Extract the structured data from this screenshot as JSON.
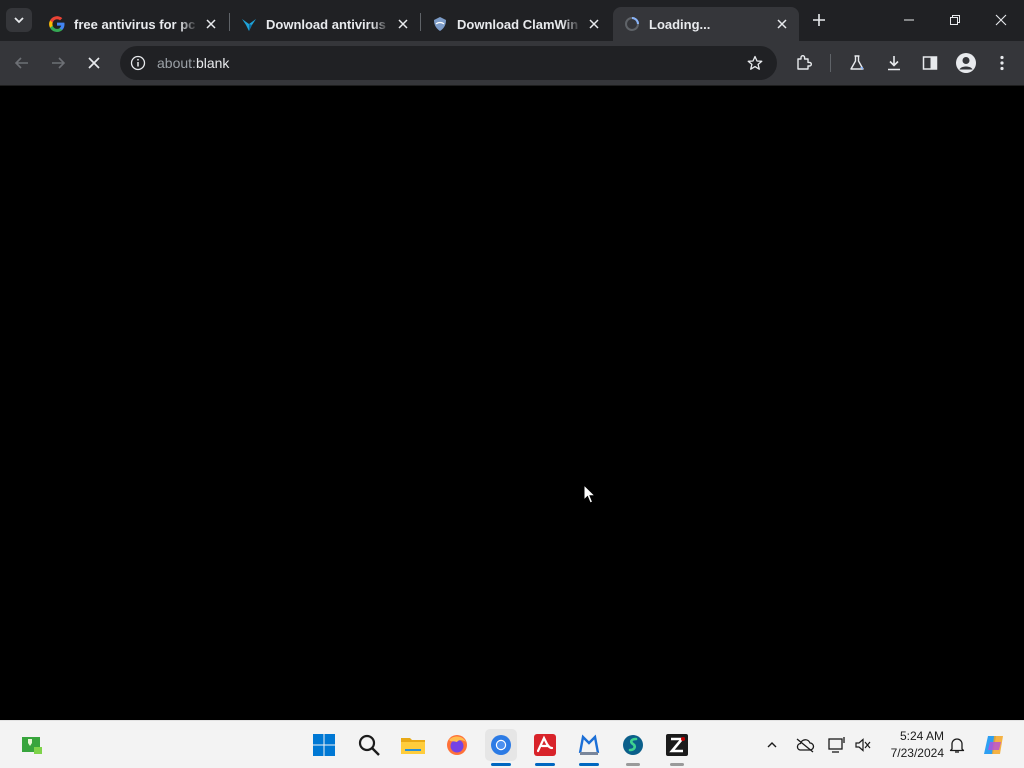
{
  "browser": {
    "tabs": [
      {
        "title": "free antivirus for pc - Google Search",
        "favicon": "google-g-icon",
        "active": false
      },
      {
        "title": "Download antivirus software",
        "favicon": "download-arrow-icon",
        "active": false
      },
      {
        "title": "Download ClamWin Free Antivirus",
        "favicon": "clamwin-shield-icon",
        "active": false
      },
      {
        "title": "Loading...",
        "favicon": "loading-spinner-icon",
        "active": true
      }
    ],
    "address": {
      "scheme": "about:",
      "rest": "blank"
    }
  },
  "taskbar": {
    "apps": [
      "start-button",
      "search",
      "file-explorer",
      "firefox",
      "chrome",
      "avira",
      "malwarebytes",
      "app-s",
      "filezilla"
    ],
    "clock": {
      "time": "5:24 AM",
      "date": "7/23/2024"
    }
  },
  "colors": {
    "accent": "#0067c0",
    "chrome_dark": "#202124",
    "chrome_toolbar": "#35363a"
  }
}
